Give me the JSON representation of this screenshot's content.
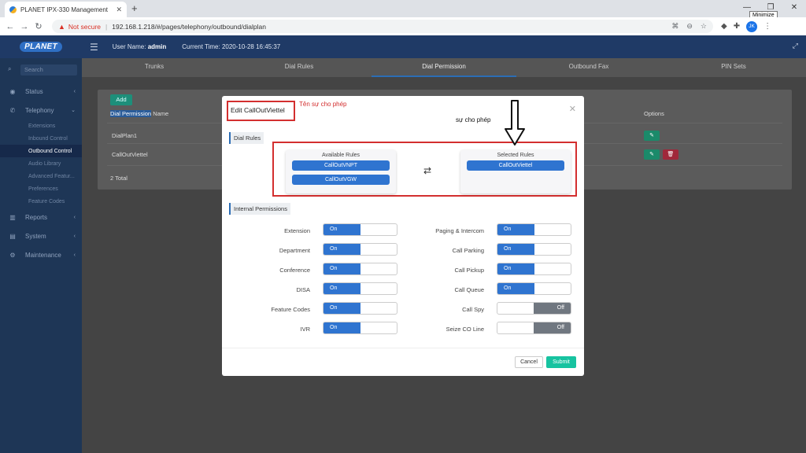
{
  "browser": {
    "tab_title": "PLANET IPX-330 Management",
    "tab_close": "✕",
    "new_tab": "+",
    "not_secure": "Not secure",
    "url": "192.168.1.218/#/pages/telephony/outbound/dialplan",
    "tooltip": "Minimize",
    "avatar": "JK"
  },
  "header": {
    "logo": "PLANET",
    "user_label": "User Name:",
    "user_name": "admin",
    "time_label": "Current Time:",
    "time_value": "2020-10-28 16:45:37"
  },
  "sidebar": {
    "search_placeholder": "Search",
    "items": [
      {
        "label": "Status"
      },
      {
        "label": "Telephony"
      },
      {
        "label": "Reports"
      },
      {
        "label": "System"
      },
      {
        "label": "Maintenance"
      }
    ],
    "sub_items": [
      {
        "label": "Extensions"
      },
      {
        "label": "Inbound Control"
      },
      {
        "label": "Outbound Control"
      },
      {
        "label": "Audio Library"
      },
      {
        "label": "Advanced Featur..."
      },
      {
        "label": "Preferences"
      },
      {
        "label": "Feature Codes"
      }
    ]
  },
  "main": {
    "tabs": [
      "Trunks",
      "Dial Rules",
      "Dial Permission",
      "Outbound Fax",
      "PIN Sets"
    ],
    "add_label": "Add",
    "col_dial_permission": "Dial Permission",
    "col_name": " Name",
    "col_options": "Options",
    "rows": [
      {
        "name": "DialPlan1"
      },
      {
        "name": "CallOutViettel"
      }
    ],
    "total": "2 Total"
  },
  "modal": {
    "title": "Edit CallOutViettel",
    "annot_name": "Tên sự cho phép",
    "annot_permission": "sự cho phép",
    "dial_rules_label": "Dial Rules",
    "available_title": "Available Rules",
    "available_rules": [
      "CallOutVNPT",
      "CallOutVGW"
    ],
    "selected_title": "Selected Rules",
    "selected_rules": [
      "CallOutViettel"
    ],
    "internal_label": "Internal Permissions",
    "left_perms": [
      {
        "label": "Extension",
        "state": "On"
      },
      {
        "label": "Department",
        "state": "On"
      },
      {
        "label": "Conference",
        "state": "On"
      },
      {
        "label": "DISA",
        "state": "On"
      },
      {
        "label": "Feature Codes",
        "state": "On"
      },
      {
        "label": "IVR",
        "state": "On"
      }
    ],
    "right_perms": [
      {
        "label": "Paging & Intercom",
        "state": "On"
      },
      {
        "label": "Call Parking",
        "state": "On"
      },
      {
        "label": "Call Pickup",
        "state": "On"
      },
      {
        "label": "Call Queue",
        "state": "On"
      },
      {
        "label": "Call Spy",
        "state": "Off"
      },
      {
        "label": "Seize CO Line",
        "state": "Off"
      }
    ],
    "cancel_label": "Cancel",
    "submit_label": "Submit"
  },
  "colors": {
    "accent": "#2f74d0",
    "submit": "#17c3a0",
    "annotation": "#d32f2f"
  }
}
